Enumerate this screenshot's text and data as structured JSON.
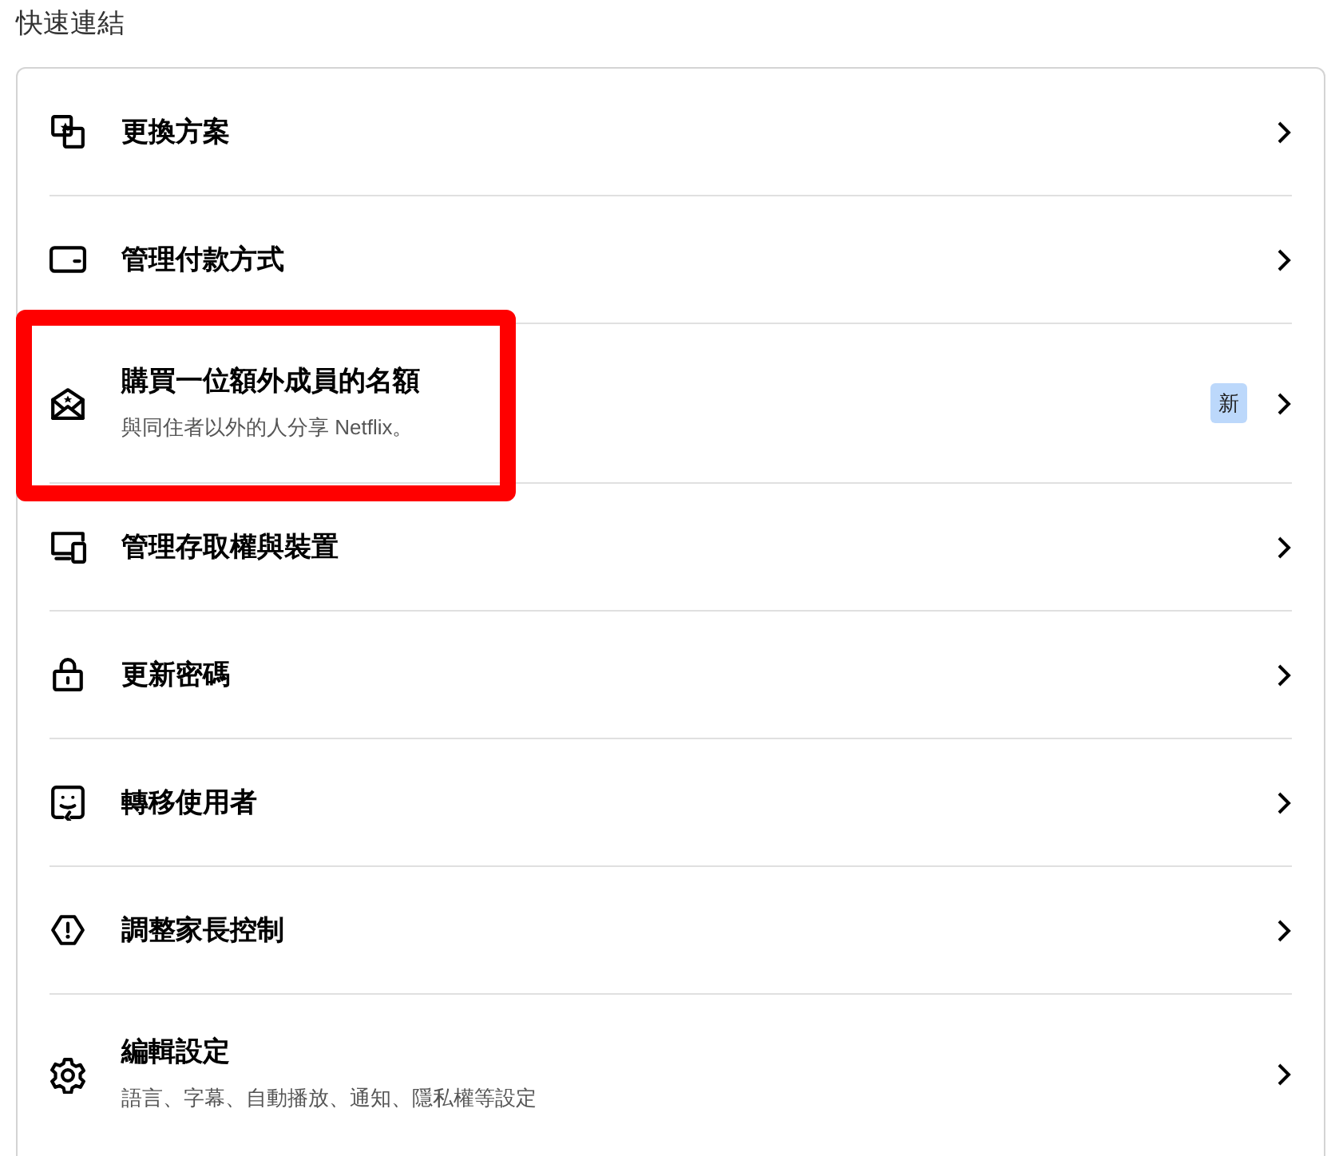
{
  "section_title": "快速連結",
  "items": [
    {
      "kind": "plan",
      "label": "更換方案",
      "highlighted": false
    },
    {
      "kind": "card",
      "label": "管理付款方式",
      "highlighted": false
    },
    {
      "kind": "envelope",
      "label": "購買一位額外成員的名額",
      "description": "與同住者以外的人分享 Netflix。",
      "badge": "新",
      "highlighted": true
    },
    {
      "kind": "devices",
      "label": "管理存取權與裝置",
      "highlighted": false
    },
    {
      "kind": "lock",
      "label": "更新密碼",
      "highlighted": false
    },
    {
      "kind": "profile",
      "label": "轉移使用者",
      "highlighted": false
    },
    {
      "kind": "warning",
      "label": "調整家長控制",
      "highlighted": false
    },
    {
      "kind": "gear",
      "label": "編輯設定",
      "description": "語言、字幕、自動播放、通知、隱私權等設定",
      "highlighted": false
    }
  ]
}
